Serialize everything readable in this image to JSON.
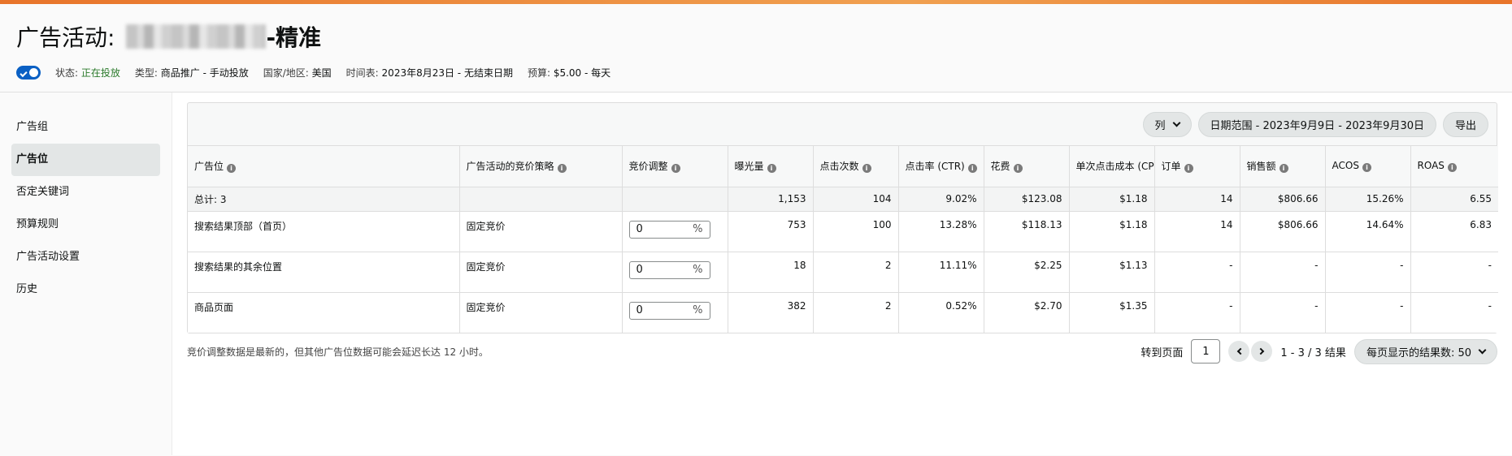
{
  "header": {
    "title_prefix": "广告活动:",
    "title_suffix": "-精准",
    "status_label": "状态:",
    "status_value": "正在投放",
    "type_label": "类型:",
    "type_value": "商品推广 - 手动投放",
    "country_label": "国家/地区:",
    "country_value": "美国",
    "schedule_label": "时间表:",
    "schedule_value": "2023年8月23日 - 无结束日期",
    "budget_label": "预算:",
    "budget_value": "$5.00 - 每天"
  },
  "sidebar": {
    "items": [
      {
        "label": "广告组"
      },
      {
        "label": "广告位"
      },
      {
        "label": "否定关键词"
      },
      {
        "label": "预算规则"
      },
      {
        "label": "广告活动设置"
      },
      {
        "label": "历史"
      }
    ]
  },
  "toolbar": {
    "columns_label": "列",
    "date_range_label": "日期范围 - 2023年9月9日 - 2023年9月30日",
    "export_label": "导出"
  },
  "table": {
    "headers": [
      "广告位",
      "广告活动的竞价策略",
      "竞价调整",
      "曝光量",
      "点击次数",
      "点击率 (CTR)",
      "花费",
      "单次点击成本 (CPC)",
      "订单",
      "销售额",
      "ACOS",
      "ROAS"
    ],
    "total": {
      "label": "总计: 3",
      "strategy": "",
      "bid": "",
      "impressions": "1,153",
      "clicks": "104",
      "ctr": "9.02%",
      "spend": "$123.08",
      "cpc": "$1.18",
      "orders": "14",
      "sales": "$806.66",
      "acos": "15.26%",
      "roas": "6.55"
    },
    "rows": [
      {
        "placement": "搜索结果顶部（首页）",
        "strategy": "固定竞价",
        "bid": "0",
        "pct": "%",
        "impressions": "753",
        "clicks": "100",
        "ctr": "13.28%",
        "spend": "$118.13",
        "cpc": "$1.18",
        "orders": "14",
        "sales": "$806.66",
        "acos": "14.64%",
        "roas": "6.83"
      },
      {
        "placement": "搜索结果的其余位置",
        "strategy": "固定竞价",
        "bid": "0",
        "pct": "%",
        "impressions": "18",
        "clicks": "2",
        "ctr": "11.11%",
        "spend": "$2.25",
        "cpc": "$1.13",
        "orders": "-",
        "sales": "-",
        "acos": "-",
        "roas": "-"
      },
      {
        "placement": "商品页面",
        "strategy": "固定竞价",
        "bid": "0",
        "pct": "%",
        "impressions": "382",
        "clicks": "2",
        "ctr": "0.52%",
        "spend": "$2.70",
        "cpc": "$1.35",
        "orders": "-",
        "sales": "-",
        "acos": "-",
        "roas": "-"
      }
    ]
  },
  "footer": {
    "note": "竞价调整数据是最新的，但其他广告位数据可能会延迟长达 12 小时。",
    "goto_label": "转到页面",
    "page_value": "1",
    "results_label": "1 - 3 / 3 结果",
    "per_page_label": "每页显示的结果数:  50"
  }
}
